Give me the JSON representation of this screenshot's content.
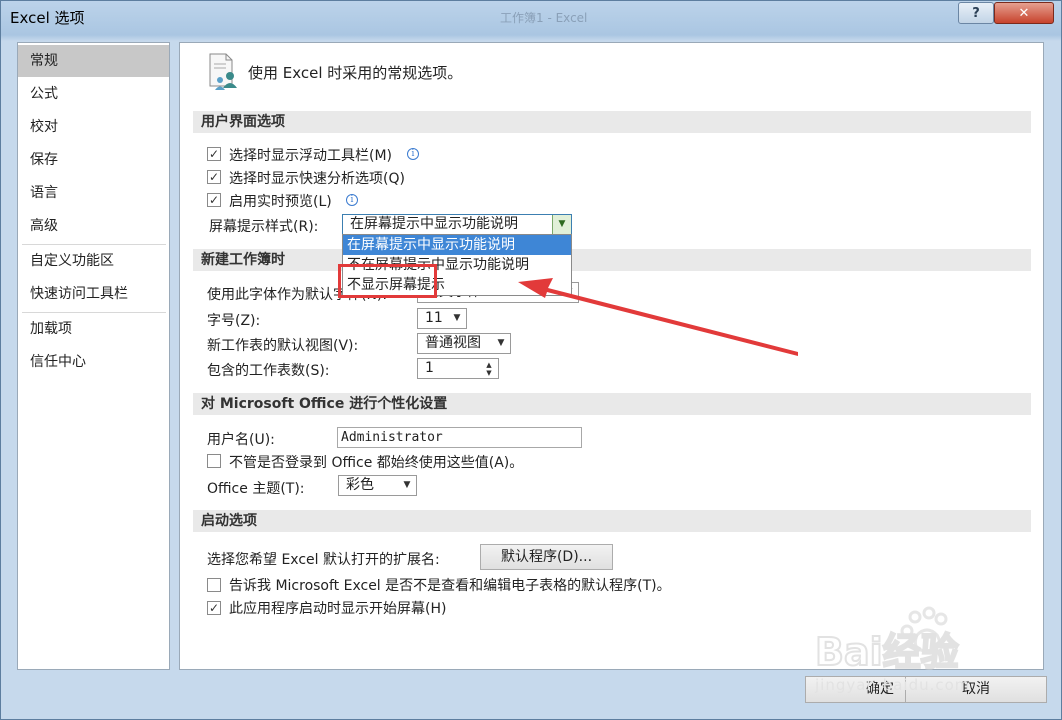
{
  "window": {
    "title": "Excel 选项",
    "document_title": "工作簿1 - Excel",
    "help_label": "?",
    "close_label": "✕"
  },
  "sidebar": {
    "items": [
      {
        "label": "常规",
        "selected": true
      },
      {
        "label": "公式"
      },
      {
        "label": "校对"
      },
      {
        "label": "保存"
      },
      {
        "label": "语言"
      },
      {
        "label": "高级"
      },
      {
        "label": "自定义功能区"
      },
      {
        "label": "快速访问工具栏"
      },
      {
        "label": "加载项"
      },
      {
        "label": "信任中心"
      }
    ]
  },
  "main": {
    "header_text": "使用 Excel 时采用的常规选项。",
    "ui_section": {
      "title": "用户界面选项",
      "show_mini_toolbar": {
        "label": "选择时显示浮动工具栏(M)",
        "checked": true
      },
      "show_quick_analysis": {
        "label": "选择时显示快速分析选项(Q)",
        "checked": true
      },
      "live_preview": {
        "label": "启用实时预览(L)",
        "checked": true
      },
      "screentip_style": {
        "label": "屏幕提示样式(R):",
        "value": "在屏幕提示中显示功能说明",
        "options": [
          "在屏幕提示中显示功能说明",
          "不在屏幕提示中显示功能说明",
          "不显示屏幕提示"
        ]
      }
    },
    "new_workbook_section": {
      "title": "新建工作簿时",
      "font_label": "使用此字体作为默认字体(N):",
      "font_value": "正文字体",
      "size_label": "字号(Z):",
      "size_value": "11",
      "view_label": "新工作表的默认视图(V):",
      "view_value": "普通视图",
      "sheets_label": "包含的工作表数(S):",
      "sheets_value": "1"
    },
    "personalize_section": {
      "title": "对 Microsoft Office 进行个性化设置",
      "username_label": "用户名(U):",
      "username_value": "Administrator",
      "always_use": {
        "label": "不管是否登录到 Office 都始终使用这些值(A)。",
        "checked": false
      },
      "theme_label": "Office 主题(T):",
      "theme_value": "彩色"
    },
    "startup_section": {
      "title": "启动选项",
      "ext_label": "选择您希望 Excel 默认打开的扩展名:",
      "default_programs_button": "默认程序(D)...",
      "tell_me": {
        "label": "告诉我 Microsoft Excel 是否不是查看和编辑电子表格的默认程序(T)。",
        "checked": false
      },
      "show_start_screen": {
        "label": "此应用程序启动时显示开始屏幕(H)",
        "checked": true
      }
    }
  },
  "footer": {
    "ok_label": "确定",
    "cancel_label": "取消"
  },
  "watermark": {
    "brand": "Bai经验",
    "sub": "jingyan.baidu.com"
  },
  "colors": {
    "annotation_red": "#e23a3a",
    "dropdown_highlight": "#3e86d6"
  }
}
